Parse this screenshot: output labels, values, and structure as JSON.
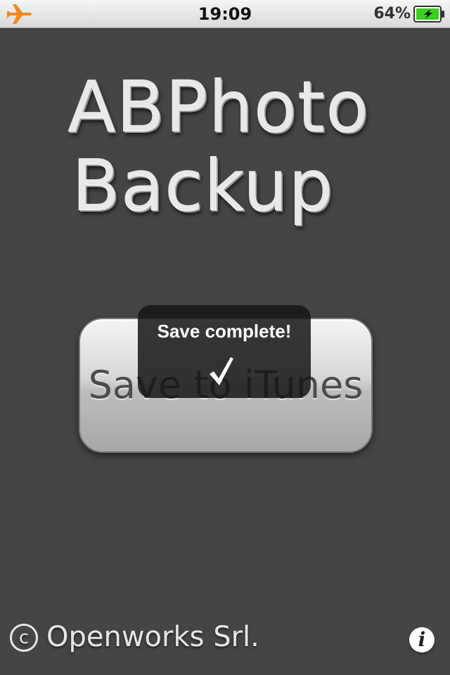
{
  "status_bar": {
    "time": "19:09",
    "battery_percent": "64%",
    "icons": [
      "airplane-icon",
      "battery-charging-icon"
    ],
    "airplane_color": "#f0891e",
    "battery_color": "#3ccf1e"
  },
  "app": {
    "title_line1": "ABPhoto",
    "title_line2": "Backup"
  },
  "save_button": {
    "label": "Save to iTunes"
  },
  "hud": {
    "message": "Save complete!",
    "icon": "checkmark-icon"
  },
  "footer": {
    "copyright_symbol": "c",
    "copyright_text": "Openworks Srl.",
    "info_label": "i"
  },
  "colors": {
    "background": "#454545",
    "title": "#e8e8e8"
  }
}
